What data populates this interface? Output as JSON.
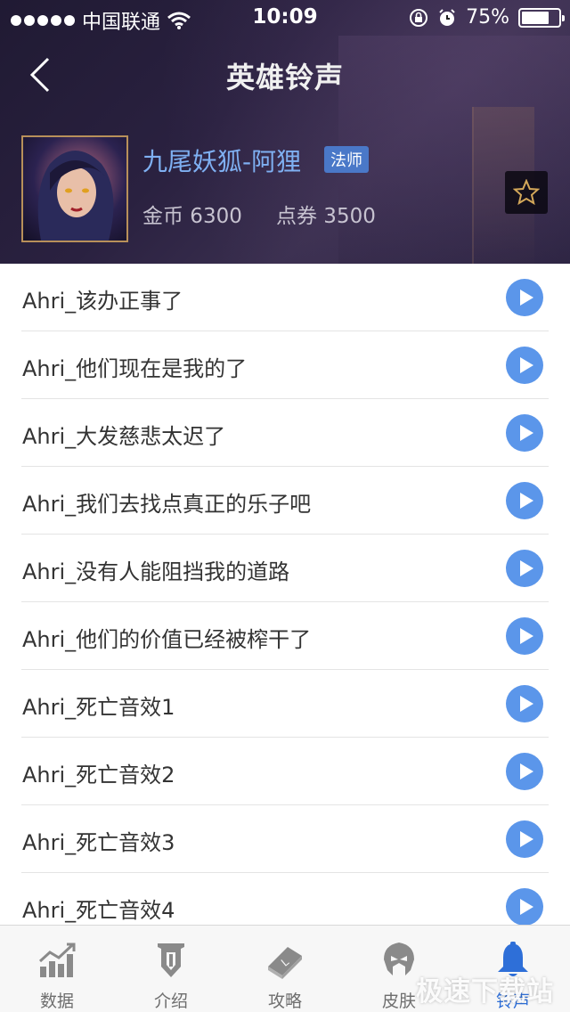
{
  "status_bar": {
    "carrier": "中国联通",
    "time": "10:09",
    "battery": "75%",
    "battery_level": 0.75
  },
  "header": {
    "title": "英雄铃声",
    "hero_name": "九尾妖狐-阿狸",
    "role": "法师",
    "gold": "金币 6300",
    "coupon": "点券 3500"
  },
  "ringtones": [
    {
      "label": "Ahri_该办正事了"
    },
    {
      "label": "Ahri_他们现在是我的了"
    },
    {
      "label": "Ahri_大发慈悲太迟了"
    },
    {
      "label": "Ahri_我们去找点真正的乐子吧"
    },
    {
      "label": "Ahri_没有人能阻挡我的道路"
    },
    {
      "label": "Ahri_他们的价值已经被榨干了"
    },
    {
      "label": "Ahri_死亡音效1"
    },
    {
      "label": "Ahri_死亡音效2"
    },
    {
      "label": "Ahri_死亡音效3"
    },
    {
      "label": "Ahri_死亡音效4"
    }
  ],
  "tabs": [
    {
      "label": "数据",
      "icon": "chart-icon"
    },
    {
      "label": "介绍",
      "icon": "banner-icon"
    },
    {
      "label": "攻略",
      "icon": "book-icon"
    },
    {
      "label": "皮肤",
      "icon": "helmet-icon"
    },
    {
      "label": "铃声",
      "icon": "bell-icon"
    }
  ],
  "watermark": "极速下载站",
  "colors": {
    "accent": "#5b96ea",
    "hero_name": "#7fb0f2",
    "role_badge": "#4a78c8",
    "active_tab": "#2e6fd8"
  }
}
